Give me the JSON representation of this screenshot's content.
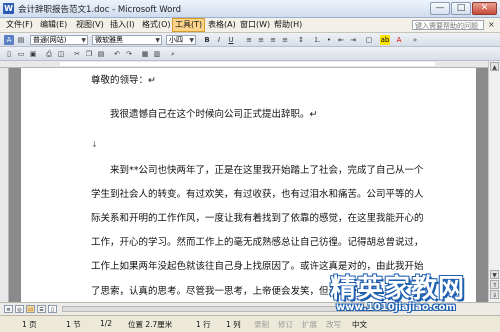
{
  "window": {
    "title": "会计辞职报告范文1.doc - Microsoft Word",
    "min_label": "—",
    "max_label": "□",
    "close_label": "✕"
  },
  "menu": {
    "items": [
      {
        "label": "文件(F)"
      },
      {
        "label": "编辑(E)"
      },
      {
        "label": "视图(V)"
      },
      {
        "label": "插入(I)"
      },
      {
        "label": "格式(O)"
      },
      {
        "label": "工具(T)",
        "active": true
      },
      {
        "label": "表格(A)"
      },
      {
        "label": "窗口(W)"
      },
      {
        "label": "帮助(H)"
      }
    ],
    "help_placeholder": "键入需要帮助的问题",
    "close_label": "×"
  },
  "toolbar": {
    "style_value": "普通(网站)",
    "font_value": "微软雅黑",
    "size_value": "小四",
    "bold": "B",
    "italic": "I",
    "underline": "U",
    "font_color_label": "A"
  },
  "document": {
    "lines": [
      "尊敬的领导：↵",
      "我很遗憾自己在这个时候向公司正式提出辞职。↵",
      "↓",
      "来到**公司也快两年了，正是在这里我开始踏上了社会，完成了自己从一个",
      "学生到社会人的转变。有过欢笑，有过收获，也有过泪水和痛苦。公司平等的人",
      "际关系和开明的工作作风，一度让我有着找到了依靠的感觉，在这里我能开心的",
      "工作，开心的学习。然而工作上的毫无成熟感总让自己彷徨。记得胡总曾说过，",
      "工作上如果两年没起色就该往自己身上找原因了。或许这真是对的，由此我开始",
      "了思索，认真的思考。尽管我一思考，上帝便会发笑，但这笑带"
    ]
  },
  "status": {
    "page": "1 页",
    "section": "1 节",
    "page_of": "1/2",
    "position": "位置 2.7厘米",
    "line": "1 行",
    "column": "1 列",
    "rec": "录制",
    "trk": "修订",
    "ext": "扩展",
    "ovr": "改写",
    "lang": "中文"
  },
  "watermark": {
    "main": "精英家教网",
    "url": "www.1010jiajiao.com"
  },
  "colors": {
    "active_menu": "#fcd48a",
    "watermark_outline": "#1e5fb0"
  }
}
